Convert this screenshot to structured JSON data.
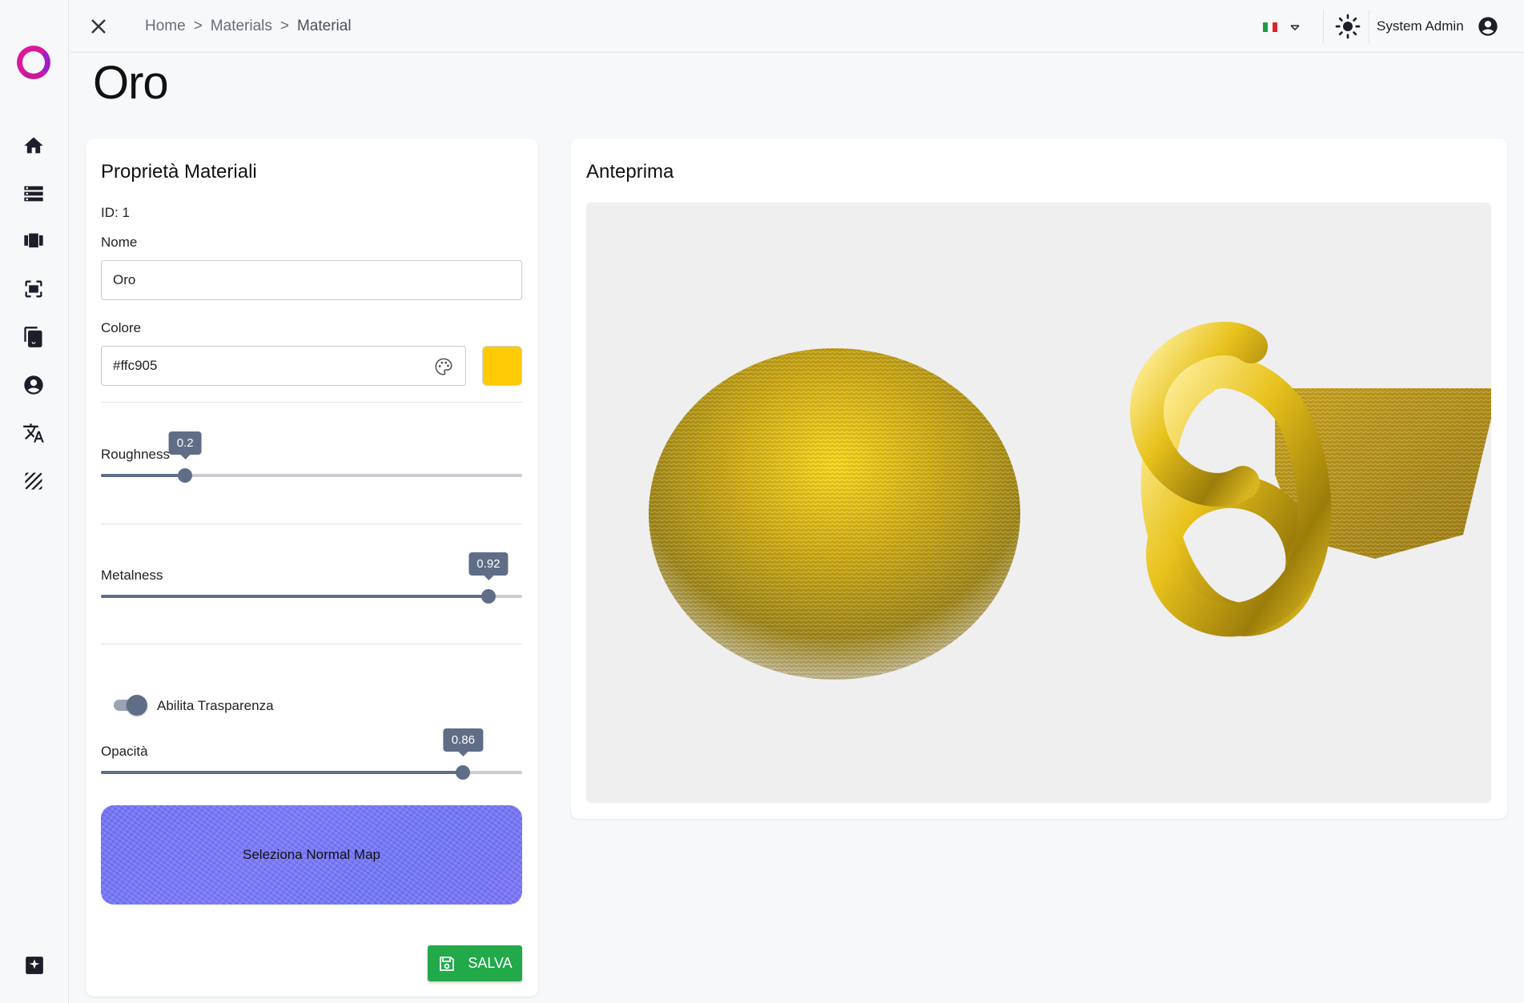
{
  "sidebar": {
    "logo": "brand-logo-ring",
    "items": [
      {
        "icon": "home-icon"
      },
      {
        "icon": "storage-list-icon"
      },
      {
        "icon": "carousel-icon"
      },
      {
        "icon": "scan-frame-icon"
      },
      {
        "icon": "documents-icon"
      },
      {
        "icon": "account-circle-icon"
      },
      {
        "icon": "translate-icon"
      },
      {
        "icon": "texture-icon"
      }
    ],
    "footer_icon": "feedback-icon"
  },
  "topbar": {
    "breadcrumb": [
      "Home",
      "Materials",
      "Material"
    ],
    "separator": ">",
    "language_flag": "it-flag",
    "user_name": "System Admin"
  },
  "page": {
    "title": "Oro"
  },
  "properties": {
    "title": "Proprietà Materiali",
    "id_text": "ID: 1",
    "name_label": "Nome",
    "name_value": "Oro",
    "color_label": "Colore",
    "color_value": "#ffc905",
    "swatch_color": "#ffc905",
    "roughness": {
      "label": "Roughness",
      "value": "0.2",
      "fraction": 0.2
    },
    "metalness": {
      "label": "Metalness",
      "value": "0.92",
      "fraction": 0.92
    },
    "transparency_label": "Abilita Trasparenza",
    "transparency_enabled": true,
    "opacity": {
      "label": "Opacità",
      "value": "0.86",
      "fraction": 0.86
    },
    "normal_map_label": "Seleziona Normal Map",
    "save_label": "SALVA"
  },
  "preview": {
    "title": "Anteprima"
  },
  "colors": {
    "accent": "#5f6d87",
    "save": "#22a94a",
    "gold": "#ffc905"
  }
}
